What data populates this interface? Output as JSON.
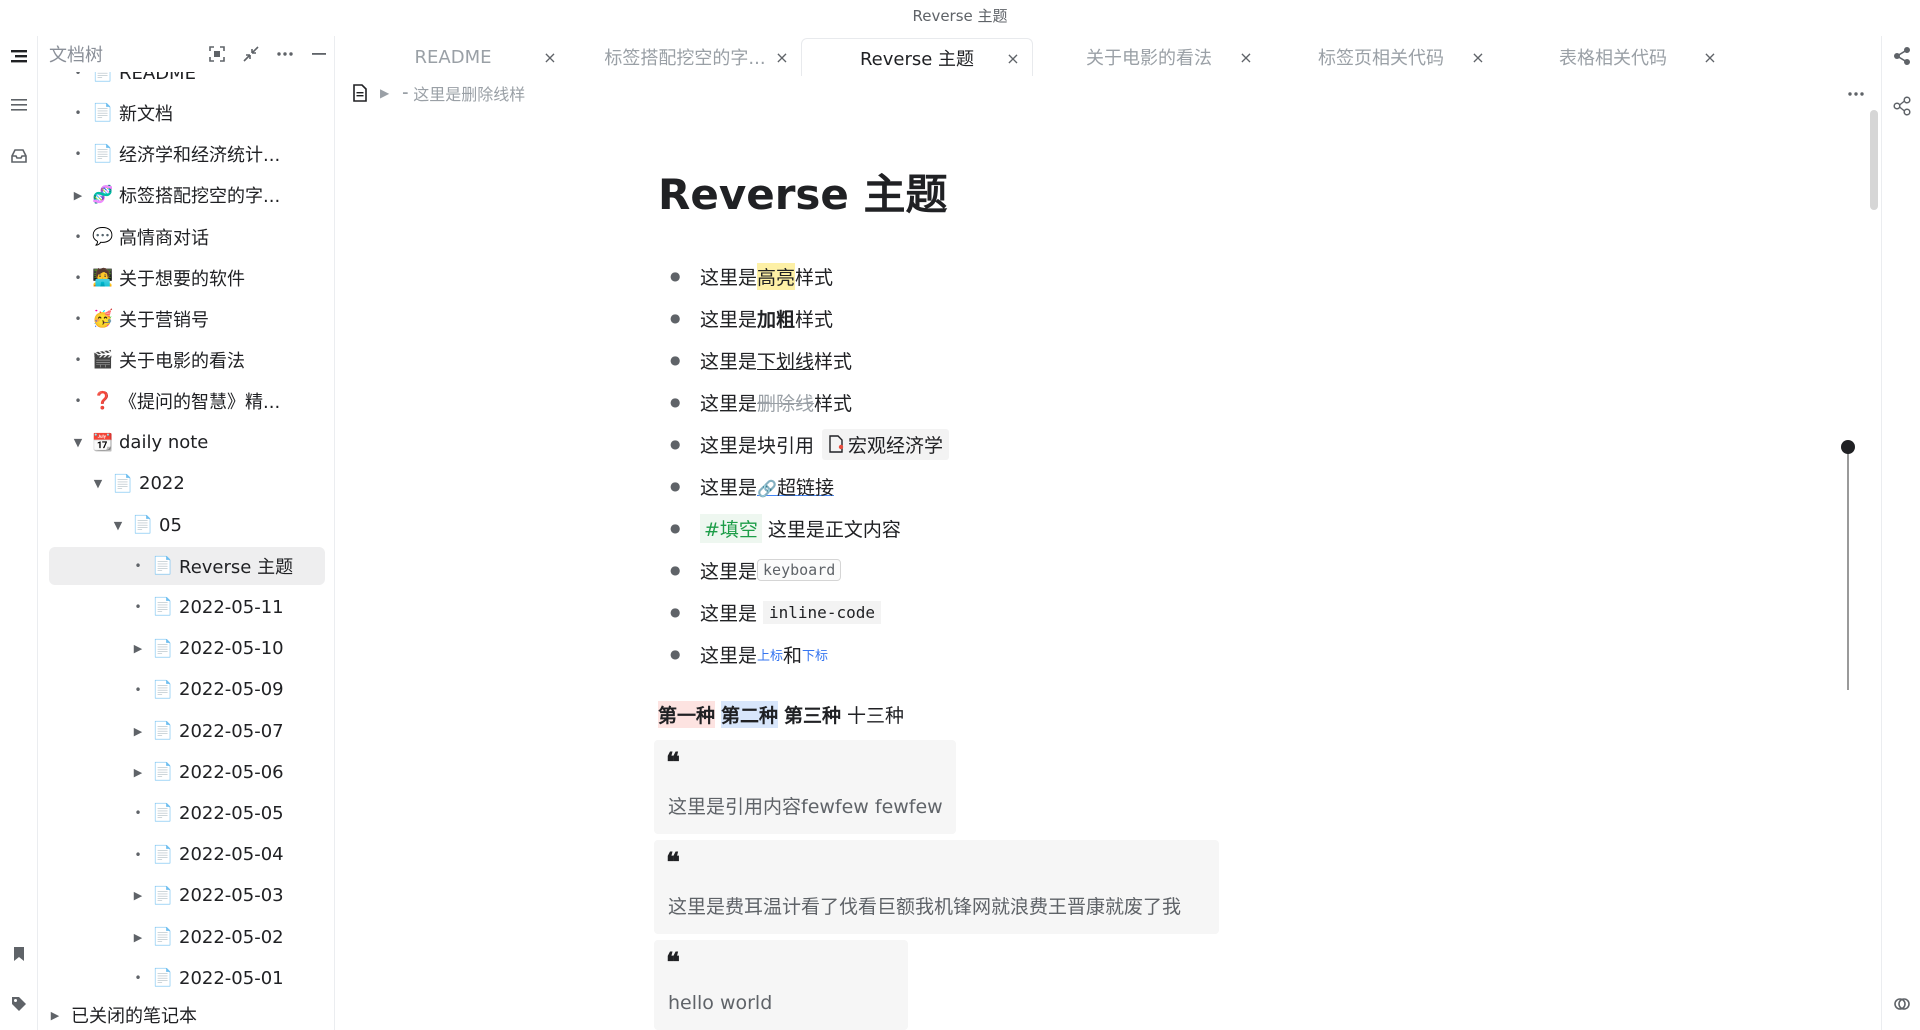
{
  "window": {
    "title": "Reverse 主题"
  },
  "left_dock": {
    "icons": [
      "file-tree-icon",
      "outline-icon",
      "inbox-icon",
      "bookmark-icon",
      "tag-icon"
    ]
  },
  "tree": {
    "title": "文档树",
    "header_icons": [
      "focus-icon",
      "collapse-icon",
      "more-icon",
      "minimize-icon"
    ],
    "top_partial": "README",
    "items": [
      {
        "label": "新文档",
        "icon": "📄",
        "toggle": "dot",
        "level": 0
      },
      {
        "label": "经济学和经济统计...",
        "icon": "📄",
        "toggle": "dot",
        "level": 0
      },
      {
        "label": "标签搭配挖空的字...",
        "icon": "🧬",
        "toggle": "arrow-right",
        "level": 0
      },
      {
        "label": "高情商对话",
        "icon": "💬",
        "toggle": "dot",
        "level": 0
      },
      {
        "label": "关于想要的软件",
        "icon": "🧑‍💻",
        "toggle": "dot",
        "level": 0
      },
      {
        "label": "关于营销号",
        "icon": "🥳",
        "toggle": "dot",
        "level": 0
      },
      {
        "label": "关于电影的看法",
        "icon": "🎬",
        "toggle": "dot",
        "level": 0
      },
      {
        "label": "《提问的智慧》精...",
        "icon": "❓",
        "toggle": "dot",
        "level": 0
      },
      {
        "label": "daily note",
        "icon": "📆",
        "toggle": "arrow-down",
        "level": 0
      },
      {
        "label": "2022",
        "icon": "📄",
        "toggle": "arrow-down",
        "level": 1
      },
      {
        "label": "05",
        "icon": "📄",
        "toggle": "arrow-down",
        "level": 2
      },
      {
        "label": "Reverse 主题",
        "icon": "📄",
        "toggle": "dot",
        "level": 3,
        "selected": true
      },
      {
        "label": "2022-05-11",
        "icon": "📄",
        "toggle": "dot",
        "level": 3
      },
      {
        "label": "2022-05-10",
        "icon": "📄",
        "toggle": "arrow-right",
        "level": 3
      },
      {
        "label": "2022-05-09",
        "icon": "📄",
        "toggle": "dot",
        "level": 3
      },
      {
        "label": "2022-05-07",
        "icon": "📄",
        "toggle": "arrow-right",
        "level": 3
      },
      {
        "label": "2022-05-06",
        "icon": "📄",
        "toggle": "arrow-right",
        "level": 3
      },
      {
        "label": "2022-05-05",
        "icon": "📄",
        "toggle": "dot",
        "level": 3
      },
      {
        "label": "2022-05-04",
        "icon": "📄",
        "toggle": "dot",
        "level": 3
      },
      {
        "label": "2022-05-03",
        "icon": "📄",
        "toggle": "arrow-right",
        "level": 3
      },
      {
        "label": "2022-05-02",
        "icon": "📄",
        "toggle": "arrow-right",
        "level": 3
      },
      {
        "label": "2022-05-01",
        "icon": "📄",
        "toggle": "dot",
        "level": 3
      }
    ],
    "closed_notebooks": "已关闭的笔记本"
  },
  "tabs": [
    {
      "label": "README",
      "active": false
    },
    {
      "label": "标签搭配挖空的字...",
      "active": false
    },
    {
      "label": "Reverse 主题",
      "active": true
    },
    {
      "label": "关于电影的看法",
      "active": false
    },
    {
      "label": "标签页相关代码",
      "active": false
    },
    {
      "label": "表格相关代码",
      "active": false
    }
  ],
  "breadcrumb": {
    "text": "这里是删除线样"
  },
  "doc": {
    "title": "Reverse 主题",
    "bullets": {
      "b1": {
        "pre": "这里是",
        "mark": "高亮",
        "post": "样式"
      },
      "b2": {
        "pre": "这里是",
        "mark": "加粗",
        "post": "样式"
      },
      "b3": {
        "pre": "这里是",
        "mark": "下划线",
        "post": "样式"
      },
      "b4": {
        "pre": "这里是",
        "mark": "删除线",
        "post": "样式"
      },
      "b5": {
        "pre": "这里是块引用",
        "ref": "宏观经济学"
      },
      "b6": {
        "pre": "这里是",
        "link": "超链接"
      },
      "b7": {
        "tag": "#填空",
        "text": "这里是正文内容"
      },
      "b8": {
        "pre": "这里是",
        "kbd": "keyboard"
      },
      "b9": {
        "pre": "这里是",
        "code": "inline-code"
      },
      "b10": {
        "pre": "这里是",
        "sup": "上标",
        "mid": "和",
        "sub": "下标"
      }
    },
    "marks": {
      "m1": "第一种",
      "m2": "第二种",
      "m3": "第三种",
      "m4": "十三种"
    },
    "quotes": [
      "这里是引用内容fewfew fewfew",
      "这里是费耳温计看了伐看巨额我机锋网就浪费王晋康就废了我",
      "hello world"
    ]
  },
  "right_dock": {
    "icons": [
      "backlink-icon",
      "graph-icon",
      "history-icon"
    ]
  }
}
